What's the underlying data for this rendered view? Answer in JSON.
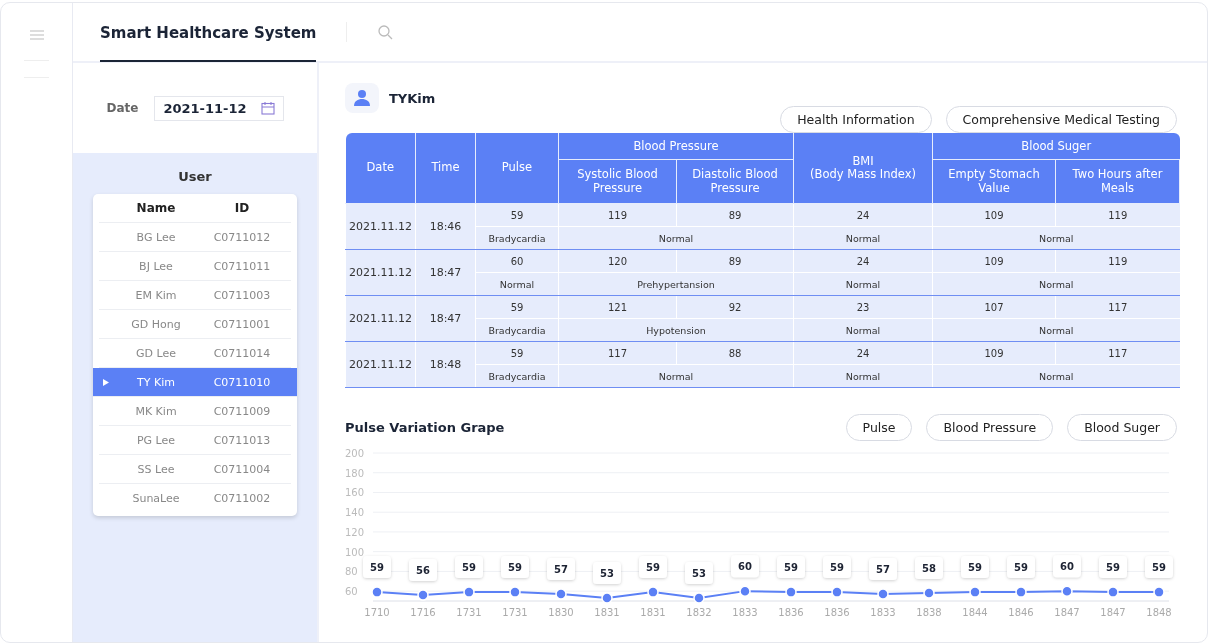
{
  "header": {
    "title": "Smart Healthcare System"
  },
  "filter": {
    "label": "Date",
    "value": "2021-11-12"
  },
  "user_panel": {
    "title": "User",
    "columns": [
      "Name",
      "ID"
    ]
  },
  "users": [
    {
      "name": "BG Lee",
      "id": "C0711012",
      "selected": false
    },
    {
      "name": "BJ Lee",
      "id": "C0711011",
      "selected": false
    },
    {
      "name": "EM Kim",
      "id": "C0711003",
      "selected": false
    },
    {
      "name": "GD Hong",
      "id": "C0711001",
      "selected": false
    },
    {
      "name": "GD Lee",
      "id": "C0711014",
      "selected": false
    },
    {
      "name": "TY Kim",
      "id": "C0711010",
      "selected": true
    },
    {
      "name": "MK Kim",
      "id": "C0711009",
      "selected": false
    },
    {
      "name": "PG Lee",
      "id": "C0711013",
      "selected": false
    },
    {
      "name": "SS Lee",
      "id": "C0711004",
      "selected": false
    },
    {
      "name": "SunaLee",
      "id": "C0711002",
      "selected": false
    }
  ],
  "patient": {
    "name": "TYKim"
  },
  "view_buttons": [
    "Health Information",
    "Comprehensive Medical Testing"
  ],
  "table": {
    "columns": {
      "date": "Date",
      "time": "Time",
      "pulse": "Pulse",
      "blood_pressure": "Blood Pressure",
      "systolic": "Systolic Blood Pressure",
      "diastolic": "Diastolic Blood Pressure",
      "bmi": "BMI\n(Body Mass Index)",
      "blood_sugar": "Blood Suger",
      "empty_stomach": "Empty Stomach Value",
      "after_meals": "Two Hours after Meals"
    },
    "rows": [
      {
        "date": "2021.11.12",
        "time": "18:46",
        "pulse": "59",
        "pulse_status": "Bradycardia",
        "systolic": "119",
        "diastolic": "89",
        "bp_status": "Normal",
        "bmi": "24",
        "bmi_status": "Normal",
        "empty_stomach": "109",
        "after_meals": "119",
        "sugar_status": "Normal"
      },
      {
        "date": "2021.11.12",
        "time": "18:47",
        "pulse": "60",
        "pulse_status": "Normal",
        "systolic": "120",
        "diastolic": "89",
        "bp_status": "Prehypertansion",
        "bmi": "24",
        "bmi_status": "Normal",
        "empty_stomach": "109",
        "after_meals": "119",
        "sugar_status": "Normal"
      },
      {
        "date": "2021.11.12",
        "time": "18:47",
        "pulse": "59",
        "pulse_status": "Bradycardia",
        "systolic": "121",
        "diastolic": "92",
        "bp_status": "Hypotension",
        "bmi": "23",
        "bmi_status": "Normal",
        "empty_stomach": "107",
        "after_meals": "117",
        "sugar_status": "Normal"
      },
      {
        "date": "2021.11.12",
        "time": "18:48",
        "pulse": "59",
        "pulse_status": "Bradycardia",
        "systolic": "117",
        "diastolic": "88",
        "bp_status": "Normal",
        "bmi": "24",
        "bmi_status": "Normal",
        "empty_stomach": "109",
        "after_meals": "117",
        "sugar_status": "Normal"
      }
    ]
  },
  "graph": {
    "title": "Pulse Variation Grape",
    "buttons": [
      "Pulse",
      "Blood Pressure",
      "Blood Suger"
    ],
    "chart_data": {
      "type": "line",
      "categories": [
        "1710",
        "1716",
        "1731",
        "1731",
        "1830",
        "1831",
        "1831",
        "1832",
        "1833",
        "1836",
        "1836",
        "1833",
        "1838",
        "1844",
        "1846",
        "1847",
        "1847",
        "1848"
      ],
      "series": [
        {
          "color": "#5b80f5",
          "marker": "circle",
          "values": [
            59,
            56,
            59,
            59,
            57,
            53,
            59,
            53,
            60,
            59,
            59,
            57,
            58,
            59,
            59,
            60,
            59,
            59
          ]
        }
      ],
      "ylim": [
        50,
        200
      ],
      "yticks": [
        60,
        80,
        100,
        120,
        140,
        160,
        180,
        200
      ],
      "grid": true,
      "data_labels": true
    }
  }
}
